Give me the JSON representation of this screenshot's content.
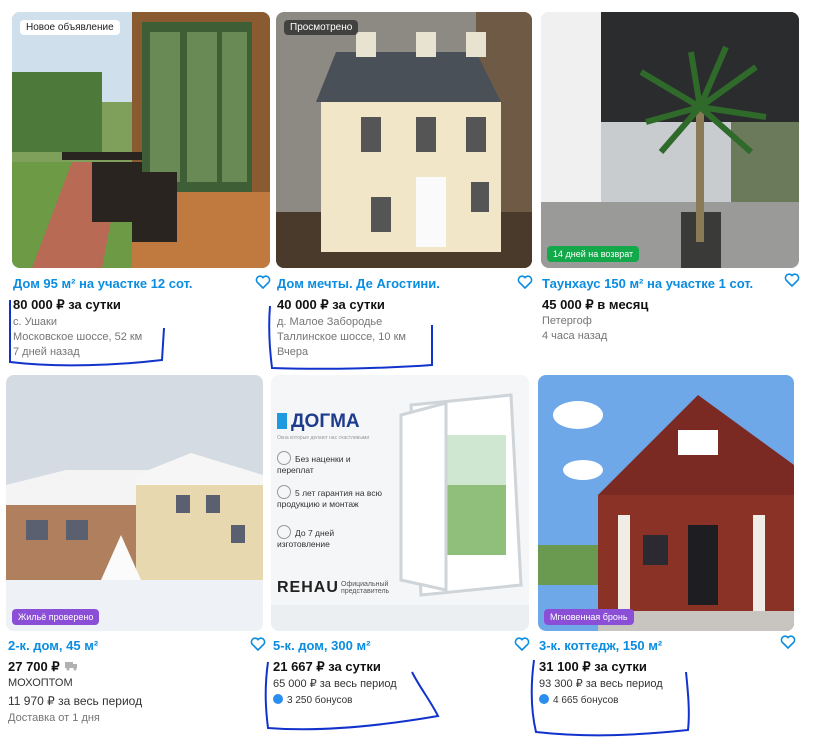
{
  "colors": {
    "title": "#0a8de0",
    "annotation": "#1133cc",
    "green_badge": "#13a84a",
    "purple_badge": "#8a4fd6"
  },
  "listings": [
    {
      "badge_top": "Новое объявление",
      "title": "Дом 95 м² на участке 12 сот.",
      "price": "80 000 ₽ за сутки",
      "lines": [
        "с. Ушаки",
        "Московское шоссе, 52 км",
        "7 дней назад"
      ]
    },
    {
      "badge_top": "Просмотрено",
      "title": "Дом мечты. Де Агостини.",
      "price": "40 000 ₽ за сутки",
      "lines": [
        "д. Малое Забородье",
        "Таллинское шоссе, 10 км",
        "Вчера"
      ]
    },
    {
      "badge_bottom": "14 дней на возврат",
      "title": "Таунхаус 150 м² на участке 1 сот.",
      "price": "45 000 ₽ в месяц",
      "lines": [
        "Петергоф",
        "4 часа назад"
      ]
    },
    {
      "badge_bottom": "Жильё проверено",
      "title": "2-к. дом, 45 м²",
      "price": "27 700 ₽",
      "lines": [
        "МОХОПТОМ",
        "11 970 ₽ за весь период",
        "Доставка от 1 дня"
      ]
    },
    {
      "title": "5-к. дом, 300 м²",
      "price": "21 667 ₽ за сутки",
      "lines": [
        "65 000 ₽ за весь период",
        "3 250 бонусов"
      ],
      "ad": {
        "brand": "ДОГМА",
        "tagline": "Окна которые делают нас счастливыми",
        "features": [
          "Без наценки и переплат",
          "5 лет гарантия на всю продукцию и монтаж",
          "До 7 дней изготовление"
        ],
        "partner": "REHAU",
        "partner_note": "Официальный представитель"
      }
    },
    {
      "badge_bottom": "Мгновенная бронь",
      "title": "3-к. коттедж, 150 м²",
      "price": "31 100 ₽ за сутки",
      "lines": [
        "93 300 ₽ за весь период",
        "4 665 бонусов"
      ]
    }
  ]
}
